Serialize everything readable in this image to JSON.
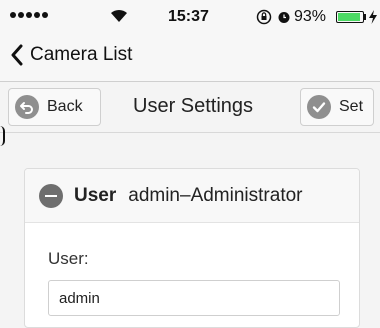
{
  "status_bar": {
    "time": "15:37",
    "battery_percent": "93%",
    "battery_level": 0.93,
    "icons": [
      "signal-dots-icon",
      "wifi-icon",
      "orientation-lock-icon",
      "alarm-icon",
      "battery-icon",
      "charging-icon"
    ]
  },
  "nav": {
    "back_label": "Camera List"
  },
  "toolbar": {
    "back_label": "Back",
    "title": "User Settings",
    "set_label": "Set"
  },
  "card": {
    "title_label": "User",
    "title_value": "admin–Administrator",
    "field_label": "User:",
    "field_value": "admin"
  },
  "colors": {
    "battery_fill": "#4cd964",
    "icon_gray": "#8f8f8f",
    "background": "#f4f4f4"
  }
}
